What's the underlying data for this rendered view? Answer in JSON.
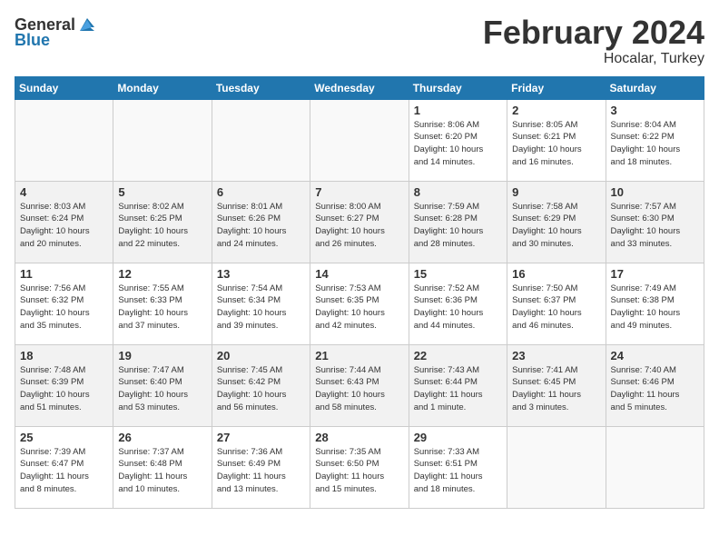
{
  "header": {
    "logo_general": "General",
    "logo_blue": "Blue",
    "title": "February 2024",
    "subtitle": "Hocalar, Turkey"
  },
  "columns": [
    "Sunday",
    "Monday",
    "Tuesday",
    "Wednesday",
    "Thursday",
    "Friday",
    "Saturday"
  ],
  "weeks": [
    [
      {
        "day": "",
        "info": ""
      },
      {
        "day": "",
        "info": ""
      },
      {
        "day": "",
        "info": ""
      },
      {
        "day": "",
        "info": ""
      },
      {
        "day": "1",
        "info": "Sunrise: 8:06 AM\nSunset: 6:20 PM\nDaylight: 10 hours\nand 14 minutes."
      },
      {
        "day": "2",
        "info": "Sunrise: 8:05 AM\nSunset: 6:21 PM\nDaylight: 10 hours\nand 16 minutes."
      },
      {
        "day": "3",
        "info": "Sunrise: 8:04 AM\nSunset: 6:22 PM\nDaylight: 10 hours\nand 18 minutes."
      }
    ],
    [
      {
        "day": "4",
        "info": "Sunrise: 8:03 AM\nSunset: 6:24 PM\nDaylight: 10 hours\nand 20 minutes."
      },
      {
        "day": "5",
        "info": "Sunrise: 8:02 AM\nSunset: 6:25 PM\nDaylight: 10 hours\nand 22 minutes."
      },
      {
        "day": "6",
        "info": "Sunrise: 8:01 AM\nSunset: 6:26 PM\nDaylight: 10 hours\nand 24 minutes."
      },
      {
        "day": "7",
        "info": "Sunrise: 8:00 AM\nSunset: 6:27 PM\nDaylight: 10 hours\nand 26 minutes."
      },
      {
        "day": "8",
        "info": "Sunrise: 7:59 AM\nSunset: 6:28 PM\nDaylight: 10 hours\nand 28 minutes."
      },
      {
        "day": "9",
        "info": "Sunrise: 7:58 AM\nSunset: 6:29 PM\nDaylight: 10 hours\nand 30 minutes."
      },
      {
        "day": "10",
        "info": "Sunrise: 7:57 AM\nSunset: 6:30 PM\nDaylight: 10 hours\nand 33 minutes."
      }
    ],
    [
      {
        "day": "11",
        "info": "Sunrise: 7:56 AM\nSunset: 6:32 PM\nDaylight: 10 hours\nand 35 minutes."
      },
      {
        "day": "12",
        "info": "Sunrise: 7:55 AM\nSunset: 6:33 PM\nDaylight: 10 hours\nand 37 minutes."
      },
      {
        "day": "13",
        "info": "Sunrise: 7:54 AM\nSunset: 6:34 PM\nDaylight: 10 hours\nand 39 minutes."
      },
      {
        "day": "14",
        "info": "Sunrise: 7:53 AM\nSunset: 6:35 PM\nDaylight: 10 hours\nand 42 minutes."
      },
      {
        "day": "15",
        "info": "Sunrise: 7:52 AM\nSunset: 6:36 PM\nDaylight: 10 hours\nand 44 minutes."
      },
      {
        "day": "16",
        "info": "Sunrise: 7:50 AM\nSunset: 6:37 PM\nDaylight: 10 hours\nand 46 minutes."
      },
      {
        "day": "17",
        "info": "Sunrise: 7:49 AM\nSunset: 6:38 PM\nDaylight: 10 hours\nand 49 minutes."
      }
    ],
    [
      {
        "day": "18",
        "info": "Sunrise: 7:48 AM\nSunset: 6:39 PM\nDaylight: 10 hours\nand 51 minutes."
      },
      {
        "day": "19",
        "info": "Sunrise: 7:47 AM\nSunset: 6:40 PM\nDaylight: 10 hours\nand 53 minutes."
      },
      {
        "day": "20",
        "info": "Sunrise: 7:45 AM\nSunset: 6:42 PM\nDaylight: 10 hours\nand 56 minutes."
      },
      {
        "day": "21",
        "info": "Sunrise: 7:44 AM\nSunset: 6:43 PM\nDaylight: 10 hours\nand 58 minutes."
      },
      {
        "day": "22",
        "info": "Sunrise: 7:43 AM\nSunset: 6:44 PM\nDaylight: 11 hours\nand 1 minute."
      },
      {
        "day": "23",
        "info": "Sunrise: 7:41 AM\nSunset: 6:45 PM\nDaylight: 11 hours\nand 3 minutes."
      },
      {
        "day": "24",
        "info": "Sunrise: 7:40 AM\nSunset: 6:46 PM\nDaylight: 11 hours\nand 5 minutes."
      }
    ],
    [
      {
        "day": "25",
        "info": "Sunrise: 7:39 AM\nSunset: 6:47 PM\nDaylight: 11 hours\nand 8 minutes."
      },
      {
        "day": "26",
        "info": "Sunrise: 7:37 AM\nSunset: 6:48 PM\nDaylight: 11 hours\nand 10 minutes."
      },
      {
        "day": "27",
        "info": "Sunrise: 7:36 AM\nSunset: 6:49 PM\nDaylight: 11 hours\nand 13 minutes."
      },
      {
        "day": "28",
        "info": "Sunrise: 7:35 AM\nSunset: 6:50 PM\nDaylight: 11 hours\nand 15 minutes."
      },
      {
        "day": "29",
        "info": "Sunrise: 7:33 AM\nSunset: 6:51 PM\nDaylight: 11 hours\nand 18 minutes."
      },
      {
        "day": "",
        "info": ""
      },
      {
        "day": "",
        "info": ""
      }
    ]
  ]
}
